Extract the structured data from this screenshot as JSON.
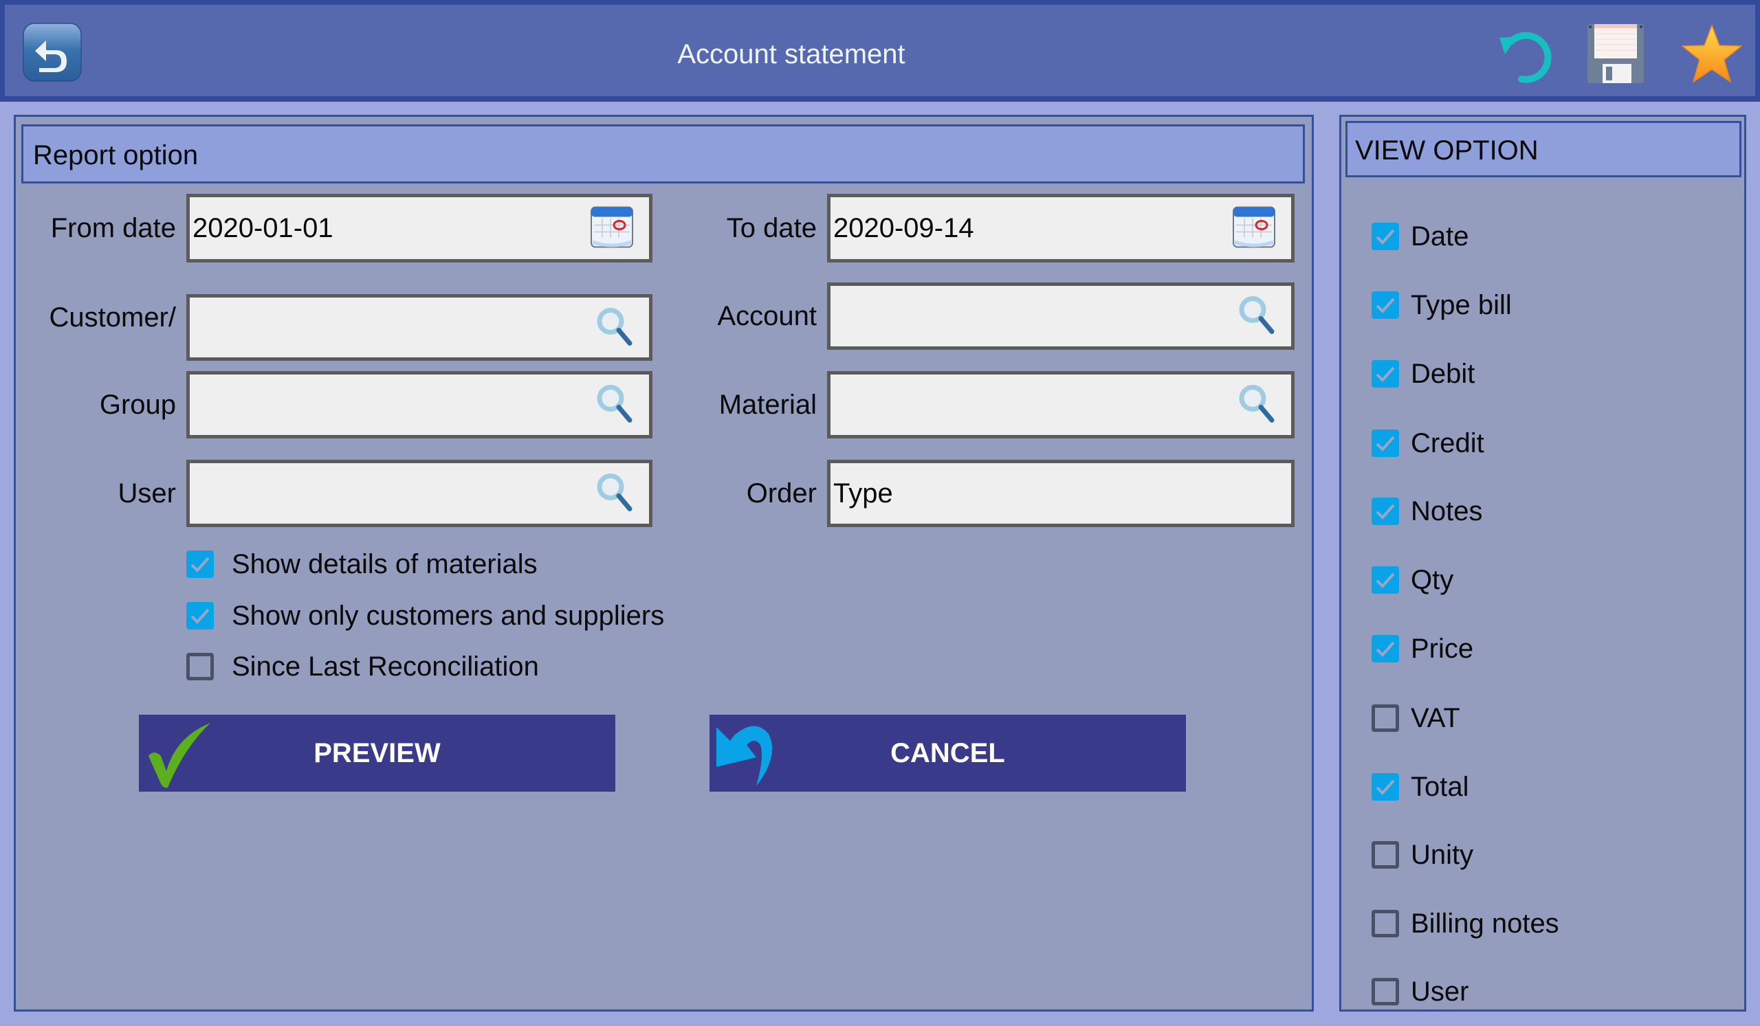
{
  "header": {
    "title": "Account statement",
    "back_icon": "back-arrow-icon",
    "refresh_icon": "refresh-icon",
    "save_icon": "floppy-disk-icon",
    "favorite_icon": "star-icon"
  },
  "report_option": {
    "title": "Report option",
    "from_date": {
      "label": "From date",
      "value": "2020-01-01",
      "icon": "calendar-icon"
    },
    "to_date": {
      "label": "To date",
      "value": "2020-09-14",
      "icon": "calendar-icon"
    },
    "customer": {
      "label": "Customer/",
      "value": "",
      "icon": "search-icon"
    },
    "account": {
      "label": "Account",
      "value": "",
      "icon": "search-icon"
    },
    "group": {
      "label": "Group",
      "value": "",
      "icon": "search-icon"
    },
    "material": {
      "label": "Material",
      "value": "",
      "icon": "search-icon"
    },
    "user": {
      "label": "User",
      "value": "",
      "icon": "search-icon"
    },
    "order": {
      "label": "Order",
      "value": "Type"
    },
    "checkboxes": [
      {
        "label": "Show details of materials",
        "checked": true
      },
      {
        "label": "Show only customers and suppliers",
        "checked": true
      },
      {
        "label": "Since Last Reconciliation",
        "checked": false
      }
    ],
    "preview_button": {
      "label": "PREVIEW",
      "icon": "checkmark-icon"
    },
    "cancel_button": {
      "label": "CANCEL",
      "icon": "undo-arrow-icon"
    }
  },
  "view_option": {
    "title": "VIEW OPTION",
    "items": [
      {
        "label": "Date",
        "checked": true
      },
      {
        "label": "Type bill",
        "checked": true
      },
      {
        "label": "Debit",
        "checked": true
      },
      {
        "label": "Credit",
        "checked": true
      },
      {
        "label": "Notes",
        "checked": true
      },
      {
        "label": "Qty",
        "checked": true
      },
      {
        "label": "Price",
        "checked": true
      },
      {
        "label": "VAT",
        "checked": false
      },
      {
        "label": "Total",
        "checked": true
      },
      {
        "label": "Unity",
        "checked": false
      },
      {
        "label": "Billing notes",
        "checked": false
      },
      {
        "label": "User",
        "checked": false
      }
    ]
  },
  "colors": {
    "header_bg": "#5669ae",
    "panel_bg": "#949dbd",
    "panel_header_bg": "#8f9fdb",
    "button_bg": "#3a3a8a",
    "checkbox_on": "#0aa3e8"
  }
}
